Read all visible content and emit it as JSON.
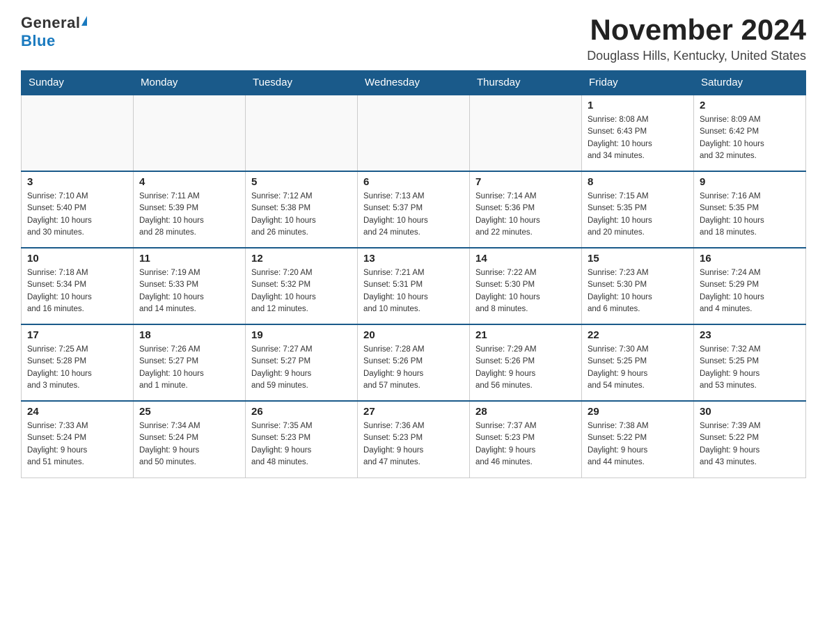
{
  "logo": {
    "general": "General",
    "blue": "Blue"
  },
  "title": "November 2024",
  "location": "Douglass Hills, Kentucky, United States",
  "headers": [
    "Sunday",
    "Monday",
    "Tuesday",
    "Wednesday",
    "Thursday",
    "Friday",
    "Saturday"
  ],
  "weeks": [
    [
      {
        "day": "",
        "info": ""
      },
      {
        "day": "",
        "info": ""
      },
      {
        "day": "",
        "info": ""
      },
      {
        "day": "",
        "info": ""
      },
      {
        "day": "",
        "info": ""
      },
      {
        "day": "1",
        "info": "Sunrise: 8:08 AM\nSunset: 6:43 PM\nDaylight: 10 hours\nand 34 minutes."
      },
      {
        "day": "2",
        "info": "Sunrise: 8:09 AM\nSunset: 6:42 PM\nDaylight: 10 hours\nand 32 minutes."
      }
    ],
    [
      {
        "day": "3",
        "info": "Sunrise: 7:10 AM\nSunset: 5:40 PM\nDaylight: 10 hours\nand 30 minutes."
      },
      {
        "day": "4",
        "info": "Sunrise: 7:11 AM\nSunset: 5:39 PM\nDaylight: 10 hours\nand 28 minutes."
      },
      {
        "day": "5",
        "info": "Sunrise: 7:12 AM\nSunset: 5:38 PM\nDaylight: 10 hours\nand 26 minutes."
      },
      {
        "day": "6",
        "info": "Sunrise: 7:13 AM\nSunset: 5:37 PM\nDaylight: 10 hours\nand 24 minutes."
      },
      {
        "day": "7",
        "info": "Sunrise: 7:14 AM\nSunset: 5:36 PM\nDaylight: 10 hours\nand 22 minutes."
      },
      {
        "day": "8",
        "info": "Sunrise: 7:15 AM\nSunset: 5:35 PM\nDaylight: 10 hours\nand 20 minutes."
      },
      {
        "day": "9",
        "info": "Sunrise: 7:16 AM\nSunset: 5:35 PM\nDaylight: 10 hours\nand 18 minutes."
      }
    ],
    [
      {
        "day": "10",
        "info": "Sunrise: 7:18 AM\nSunset: 5:34 PM\nDaylight: 10 hours\nand 16 minutes."
      },
      {
        "day": "11",
        "info": "Sunrise: 7:19 AM\nSunset: 5:33 PM\nDaylight: 10 hours\nand 14 minutes."
      },
      {
        "day": "12",
        "info": "Sunrise: 7:20 AM\nSunset: 5:32 PM\nDaylight: 10 hours\nand 12 minutes."
      },
      {
        "day": "13",
        "info": "Sunrise: 7:21 AM\nSunset: 5:31 PM\nDaylight: 10 hours\nand 10 minutes."
      },
      {
        "day": "14",
        "info": "Sunrise: 7:22 AM\nSunset: 5:30 PM\nDaylight: 10 hours\nand 8 minutes."
      },
      {
        "day": "15",
        "info": "Sunrise: 7:23 AM\nSunset: 5:30 PM\nDaylight: 10 hours\nand 6 minutes."
      },
      {
        "day": "16",
        "info": "Sunrise: 7:24 AM\nSunset: 5:29 PM\nDaylight: 10 hours\nand 4 minutes."
      }
    ],
    [
      {
        "day": "17",
        "info": "Sunrise: 7:25 AM\nSunset: 5:28 PM\nDaylight: 10 hours\nand 3 minutes."
      },
      {
        "day": "18",
        "info": "Sunrise: 7:26 AM\nSunset: 5:27 PM\nDaylight: 10 hours\nand 1 minute."
      },
      {
        "day": "19",
        "info": "Sunrise: 7:27 AM\nSunset: 5:27 PM\nDaylight: 9 hours\nand 59 minutes."
      },
      {
        "day": "20",
        "info": "Sunrise: 7:28 AM\nSunset: 5:26 PM\nDaylight: 9 hours\nand 57 minutes."
      },
      {
        "day": "21",
        "info": "Sunrise: 7:29 AM\nSunset: 5:26 PM\nDaylight: 9 hours\nand 56 minutes."
      },
      {
        "day": "22",
        "info": "Sunrise: 7:30 AM\nSunset: 5:25 PM\nDaylight: 9 hours\nand 54 minutes."
      },
      {
        "day": "23",
        "info": "Sunrise: 7:32 AM\nSunset: 5:25 PM\nDaylight: 9 hours\nand 53 minutes."
      }
    ],
    [
      {
        "day": "24",
        "info": "Sunrise: 7:33 AM\nSunset: 5:24 PM\nDaylight: 9 hours\nand 51 minutes."
      },
      {
        "day": "25",
        "info": "Sunrise: 7:34 AM\nSunset: 5:24 PM\nDaylight: 9 hours\nand 50 minutes."
      },
      {
        "day": "26",
        "info": "Sunrise: 7:35 AM\nSunset: 5:23 PM\nDaylight: 9 hours\nand 48 minutes."
      },
      {
        "day": "27",
        "info": "Sunrise: 7:36 AM\nSunset: 5:23 PM\nDaylight: 9 hours\nand 47 minutes."
      },
      {
        "day": "28",
        "info": "Sunrise: 7:37 AM\nSunset: 5:23 PM\nDaylight: 9 hours\nand 46 minutes."
      },
      {
        "day": "29",
        "info": "Sunrise: 7:38 AM\nSunset: 5:22 PM\nDaylight: 9 hours\nand 44 minutes."
      },
      {
        "day": "30",
        "info": "Sunrise: 7:39 AM\nSunset: 5:22 PM\nDaylight: 9 hours\nand 43 minutes."
      }
    ]
  ]
}
